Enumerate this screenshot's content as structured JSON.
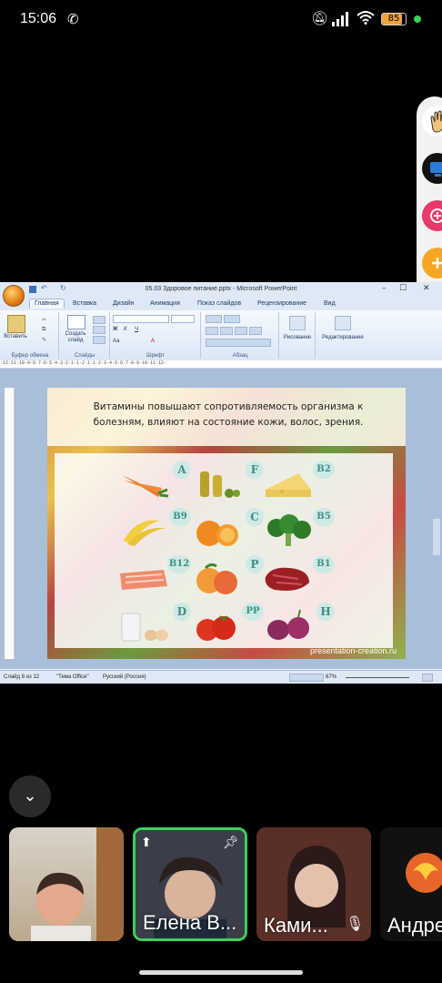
{
  "status_bar": {
    "time": "15:06",
    "battery": "85",
    "battery_level": 0.85
  },
  "powerpoint": {
    "window_title": "05.03 Здоровое питание.pptx - Microsoft PowerPoint",
    "tabs": [
      "Главная",
      "Вставка",
      "Дизайн",
      "Анимация",
      "Показ слайдов",
      "Рецензирование",
      "Вид"
    ],
    "ribbon": {
      "paste": "Вставить",
      "create_slide": "Создать слайд",
      "drawing": "Рисование",
      "editing": "Редактирование",
      "groups": [
        "Буфер обмена",
        "Слайды",
        "Шрифт",
        "Абзац"
      ]
    },
    "ruler": "·12·11·10·9·8·7·6·5·4·3·2·1·1·2·1·1·2·3·4·5·6·7·8·9·10·11·12·",
    "slide": {
      "text": "Витамины повышают сопротивляемость организма к болезням, влияют на состояние кожи, волос, зрения.",
      "vitamins": [
        "A",
        "F",
        "B2",
        "B9",
        "C",
        "B5",
        "B12",
        "P",
        "B1",
        "D",
        "PP",
        "H"
      ],
      "watermark": "presentation-creation.ru"
    },
    "status": {
      "slide": "Слайд 8 из 12",
      "theme": "\"Тема Office\"",
      "language": "Русский (Россия)",
      "zoom": "67%"
    }
  },
  "participants": [
    {
      "name": ""
    },
    {
      "name": "Елена В..."
    },
    {
      "name": "Ками..."
    },
    {
      "name": "Андре"
    }
  ],
  "colors": {
    "active_speaker": "#3ecf58",
    "vitamin_label": "#3b8f86"
  }
}
